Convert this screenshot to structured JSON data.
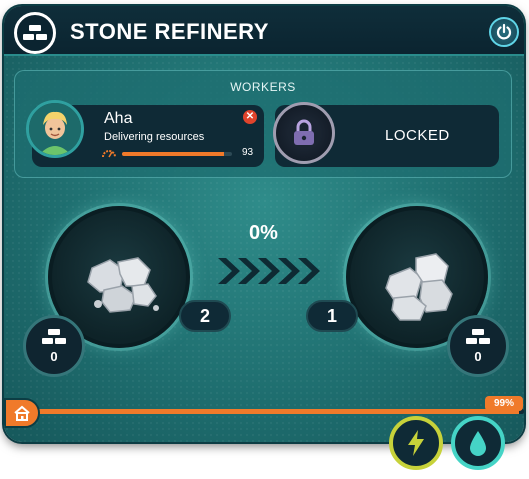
{
  "building": {
    "title": "STONE REFINERY",
    "icon": "bricks-icon"
  },
  "workers": {
    "label": "WORKERS",
    "slots": [
      {
        "name": "Aha",
        "status": "Delivering resources",
        "value": "93",
        "progress_fraction": 0.93,
        "remove_icon": "close-icon",
        "avatar_icon": "worker-avatar-icon"
      },
      {
        "locked_label": "LOCKED",
        "lock_icon": "padlock-icon"
      }
    ]
  },
  "production": {
    "progress_label": "0%",
    "input_count": "2",
    "output_count": "1",
    "input_icon": "raw-stones-icon",
    "output_icon": "refined-stone-blocks-icon",
    "arrow_icon": "chevron-right-icon"
  },
  "storage": {
    "input_stock": "0",
    "output_stock": "0"
  },
  "capacity": {
    "label": "99%",
    "fraction": 0.99
  },
  "colors": {
    "accent_orange": "#f07a2a",
    "panel_teal": "#1f6f70",
    "title_dark": "#0b2430",
    "energy_yellow": "#c7d23a",
    "water_cyan": "#45d4c6"
  }
}
